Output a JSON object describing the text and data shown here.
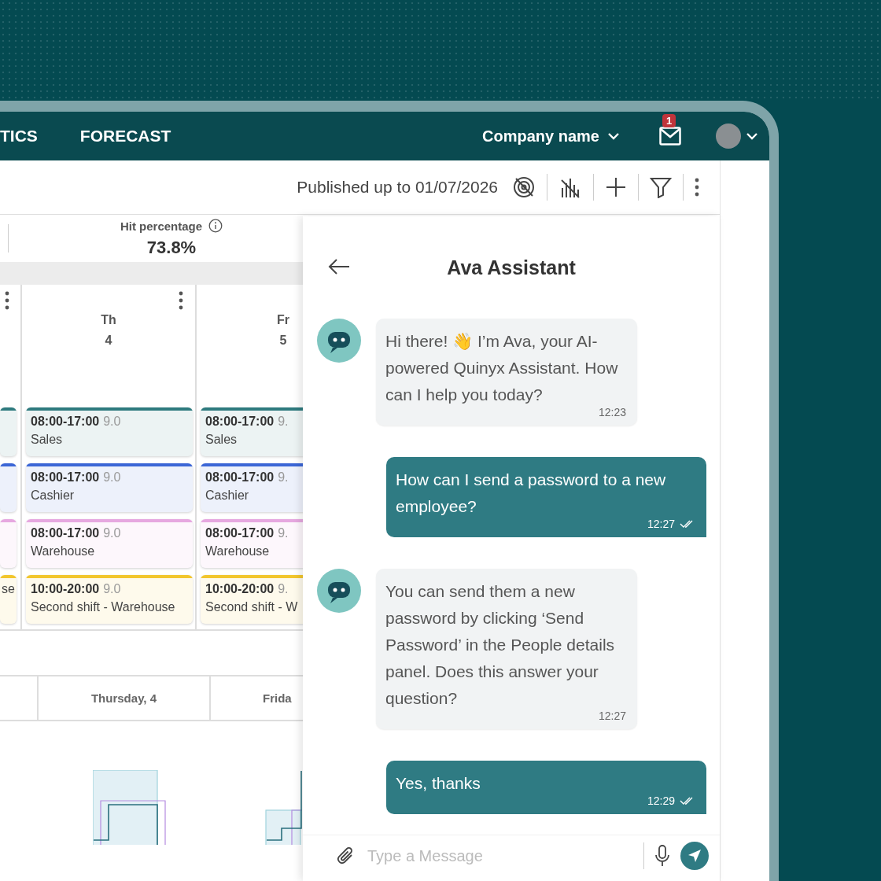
{
  "header": {
    "nav": [
      "TICS",
      "FORECAST"
    ],
    "company": "Company name",
    "mail_badge": "1"
  },
  "toolbar": {
    "published": "Published up to 01/07/2026"
  },
  "stat": {
    "label": "Hit percentage",
    "value": "73.8%"
  },
  "calendar": {
    "columns": [
      {
        "kind": "partial",
        "shifts": [
          {
            "color": "#2e7a7e"
          },
          {
            "color": "#3b66d6"
          },
          {
            "color": "#e6a8e0"
          },
          {
            "color": "#f2c62e",
            "name": "se"
          }
        ]
      },
      {
        "kind": "full",
        "day": "Th",
        "date": "4",
        "shifts": [
          {
            "time": "08:00-17:00",
            "hours": "9.0",
            "name": "Sales",
            "color": "#2e7a7e"
          },
          {
            "time": "08:00-17:00",
            "hours": "9.0",
            "name": "Cashier",
            "color": "#3b66d6"
          },
          {
            "time": "08:00-17:00",
            "hours": "9.0",
            "name": "Warehouse",
            "color": "#e6a8e0"
          },
          {
            "time": "10:00-20:00",
            "hours": "9.0",
            "name": "Second shift - Warehouse",
            "color": "#f2c62e"
          }
        ]
      },
      {
        "kind": "full",
        "day": "Fr",
        "date": "5",
        "shifts": [
          {
            "time": "08:00-17:00",
            "hours": "9.",
            "name": "Sales",
            "color": "#2e7a7e"
          },
          {
            "time": "08:00-17:00",
            "hours": "9.",
            "name": "Cashier",
            "color": "#3b66d6"
          },
          {
            "time": "08:00-17:00",
            "hours": "9.",
            "name": "Warehouse",
            "color": "#e6a8e0"
          },
          {
            "time": "10:00-20:00",
            "hours": "9.",
            "name": "Second shift - W",
            "color": "#f2c62e"
          }
        ]
      }
    ]
  },
  "summary": {
    "columns": [
      "Thursday, 4",
      "Frida"
    ]
  },
  "chat": {
    "title": "Ava Assistant",
    "messages": [
      {
        "kind": "bot",
        "text": "Hi there! 👋 I’m Ava, your AI-powered Quinyx Assistant. How can I help you today?",
        "time": "12:23"
      },
      {
        "kind": "user",
        "text": "How can I send a password to a new employee?",
        "time": "12:27",
        "read": true
      },
      {
        "kind": "bot",
        "text": "You can send them a new password by clicking ‘Send Password’ in the People details panel. Does this answer your question?",
        "time": "12:27"
      },
      {
        "kind": "user",
        "text": "Yes, thanks",
        "time": "12:29",
        "read": true
      }
    ],
    "input": {
      "placeholder": "Type a Message"
    }
  }
}
